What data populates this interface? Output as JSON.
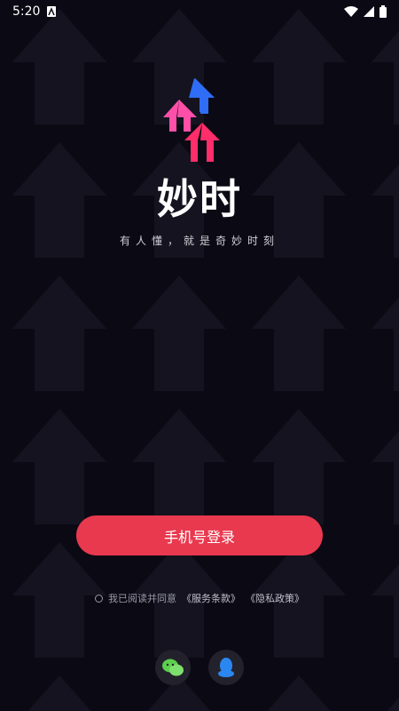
{
  "status_bar": {
    "time": "5:20"
  },
  "app": {
    "name": "妙时",
    "slogan": "有人懂，就是奇妙时刻"
  },
  "login": {
    "phone_button_label": "手机号登录"
  },
  "agreement": {
    "prefix": "我已阅读并同意",
    "terms_link": "《服务条款》",
    "privacy_link": "《隐私政策》"
  },
  "social_login": {
    "wechat_icon": "wechat-icon",
    "qq_icon": "qq-penguin-icon"
  },
  "colors": {
    "background": "#0b0a14",
    "primary_button": "#e8394f",
    "logo_blue": "#2f6df6",
    "logo_pink": "#ff4fa8",
    "logo_red": "#ff2d6a",
    "wechat_green": "#5ccf4f",
    "qq_blue": "#2b87f0"
  }
}
